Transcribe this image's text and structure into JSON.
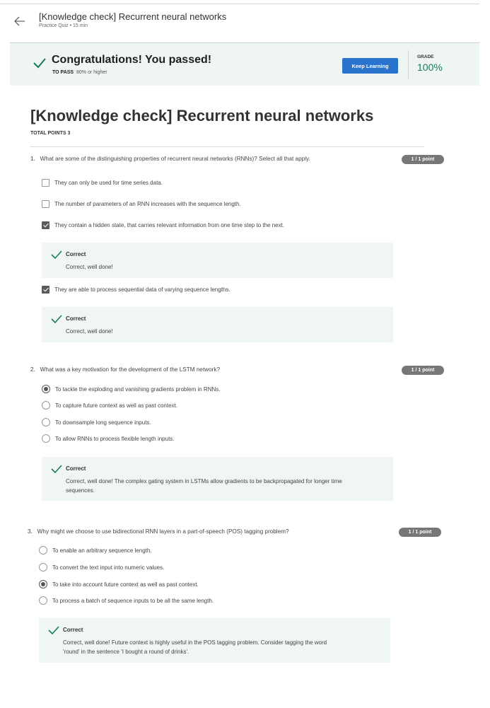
{
  "header": {
    "title": "[Knowledge check] Recurrent neural networks",
    "subtitle": "Practice Quiz • 15 min"
  },
  "banner": {
    "title": "Congratulations! You passed!",
    "to_pass_label": "TO PASS",
    "to_pass_value": "80% or higher",
    "keep_learning": "Keep Learning",
    "grade_label": "GRADE",
    "grade_value": "100%"
  },
  "quiz": {
    "title": "[Knowledge check] Recurrent neural networks",
    "total_points": "TOTAL POINTS 3"
  },
  "questions": [
    {
      "number": "1.",
      "text": "What are some of the distinguishing properties of recurrent neural networks (RNNs)? Select all that apply.",
      "points": "1 / 1 point",
      "options": [
        {
          "label": "They can only be used for time series data.",
          "checked": false
        },
        {
          "label": "The number of parameters of an RNN increases with the sequence length.",
          "checked": false
        },
        {
          "label": "They contain a hidden state, that carries relevant information from one time step to the next.",
          "checked": true
        },
        {
          "label": "They are able to process sequential data of varying sequence lengths.",
          "checked": true
        }
      ],
      "feedback": [
        {
          "title": "Correct",
          "text": "Correct, well done!"
        },
        {
          "title": "Correct",
          "text": "Correct, well done!"
        }
      ]
    },
    {
      "number": "2.",
      "text": "What was a key motivation for the development of the LSTM network?",
      "points": "1 / 1 point",
      "options": [
        {
          "label": "To tackle the exploding and vanishing gradients problem in RNNs.",
          "checked": true
        },
        {
          "label": "To capture future context as well as past context.",
          "checked": false
        },
        {
          "label": "To downsample long sequence inputs.",
          "checked": false
        },
        {
          "label": "To allow RNNs to process flexible length inputs.",
          "checked": false
        }
      ],
      "feedback": [
        {
          "title": "Correct",
          "text_line1": "Correct, well done! The complex gating system in LSTMs allow gradients to be backpropagated for longer time",
          "text_line2": "sequences."
        }
      ]
    },
    {
      "number": "3.",
      "text": "Why might we choose to use bidirectional RNN layers in a part-of-speech (POS) tagging problem?",
      "points": "1 / 1 point",
      "options": [
        {
          "label": "To enable an arbitrary sequence length.",
          "checked": false
        },
        {
          "label": "To convert the text input into numeric values.",
          "checked": false
        },
        {
          "label": "To take into account future context as well as past context.",
          "checked": true
        },
        {
          "label": "To process a batch of sequence inputs to be all the same length.",
          "checked": false
        }
      ],
      "feedback": [
        {
          "title": "Correct",
          "text_line1": "Correct, well done! Future context is highly useful in the POS tagging problem. Consider tagging the word",
          "text_line2": "'round' in the sentence 'I bought a round of drinks'."
        }
      ]
    }
  ],
  "colors": {
    "accent": "#2a73cc",
    "success": "#1a7a5e",
    "banner_bg": "#eef5f3",
    "feedback_bg": "#f0f6f4",
    "pill_bg": "#777777"
  }
}
